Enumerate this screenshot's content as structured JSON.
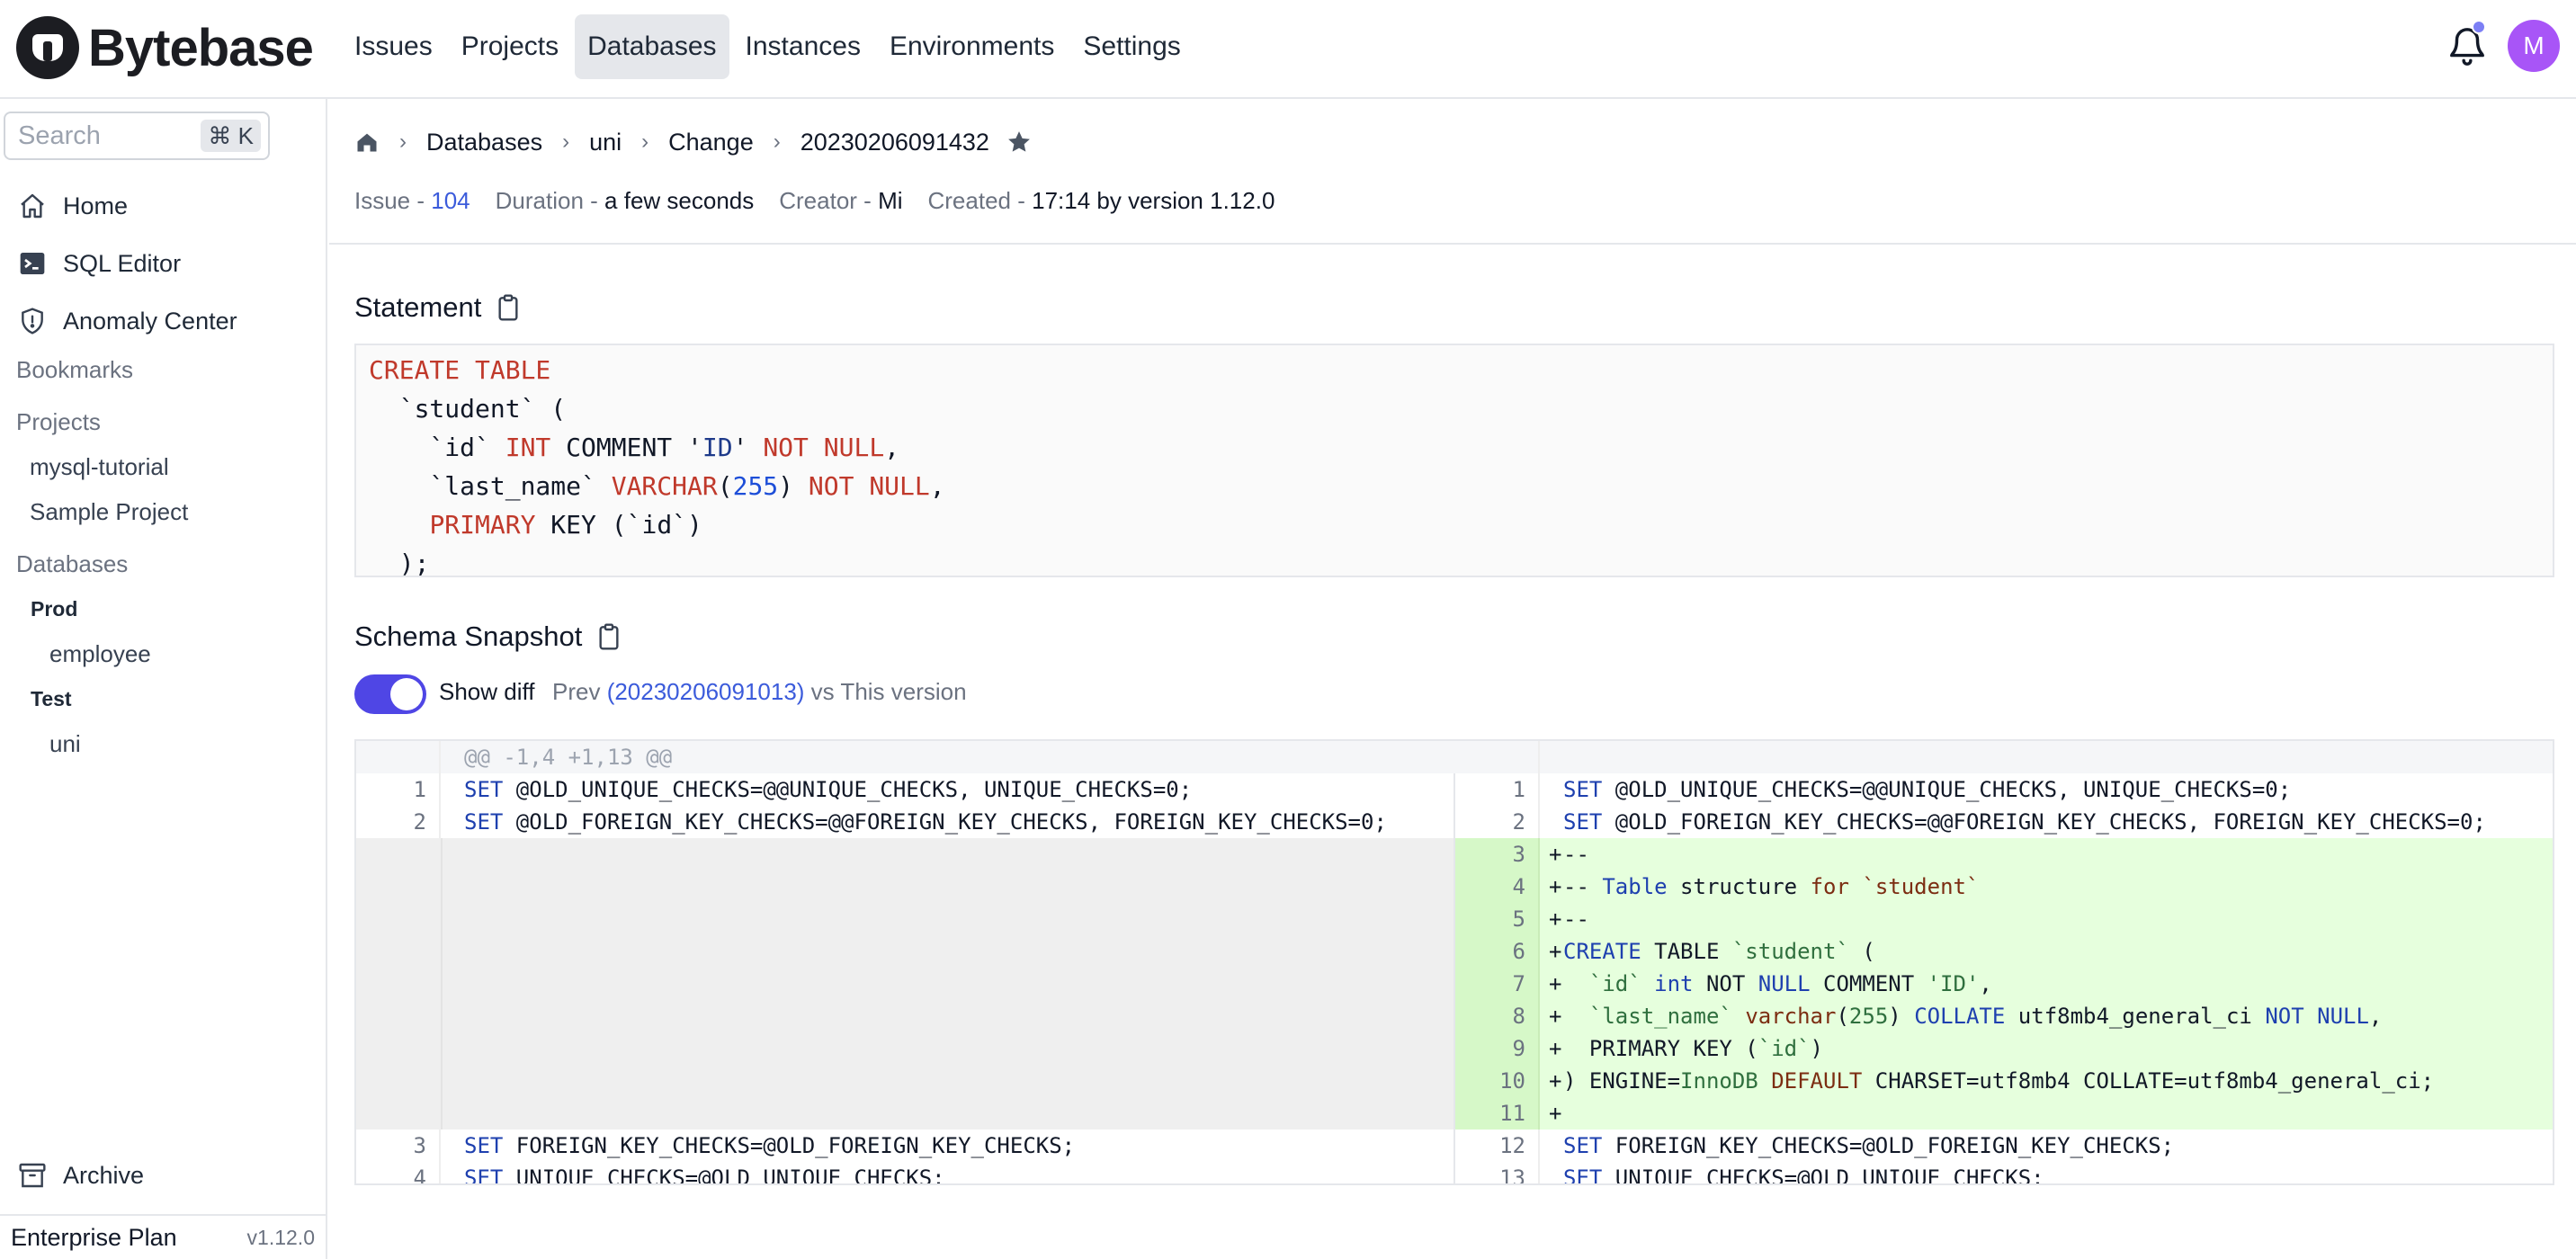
{
  "app": {
    "name": "Bytebase"
  },
  "nav": {
    "items": [
      {
        "label": "Issues",
        "active": false
      },
      {
        "label": "Projects",
        "active": false
      },
      {
        "label": "Databases",
        "active": true
      },
      {
        "label": "Instances",
        "active": false
      },
      {
        "label": "Environments",
        "active": false
      },
      {
        "label": "Settings",
        "active": false
      }
    ],
    "avatar_initial": "M"
  },
  "sidebar": {
    "search": {
      "placeholder": "Search",
      "shortcut": "⌘ K"
    },
    "home": "Home",
    "sql_editor": "SQL Editor",
    "anomaly_center": "Anomaly Center",
    "bookmarks_heading": "Bookmarks",
    "projects_heading": "Projects",
    "projects": [
      "mysql-tutorial",
      "Sample Project"
    ],
    "databases_heading": "Databases",
    "env_prod": "Prod",
    "prod_db": "employee",
    "env_test": "Test",
    "test_db": "uni",
    "archive": "Archive",
    "plan": "Enterprise Plan",
    "version": "v1.12.0"
  },
  "breadcrumb": {
    "items": [
      "Databases",
      "uni",
      "Change",
      "20230206091432"
    ]
  },
  "meta": {
    "issue_label": "Issue - ",
    "issue_value": "104",
    "duration_label": "Duration - ",
    "duration_value": "a few seconds",
    "creator_label": "Creator - ",
    "creator_value": "Mi",
    "created_label": "Created - ",
    "created_value": "17:14 by version 1.12.0"
  },
  "statement": {
    "title": "Statement"
  },
  "schema": {
    "title": "Schema Snapshot",
    "show_diff_label": "Show diff",
    "show_diff_on": true,
    "prev_prefix": "Prev ",
    "prev_version": "(20230206091013)",
    "prev_suffix": " vs This version",
    "hunk_header": "@@ -1,4 +1,13 @@"
  },
  "colors": {
    "accent": "#4f46e5",
    "link": "#3b5bdb",
    "diff_added_bg": "#e6ffdd",
    "sql_keyword": "#c0392b"
  }
}
